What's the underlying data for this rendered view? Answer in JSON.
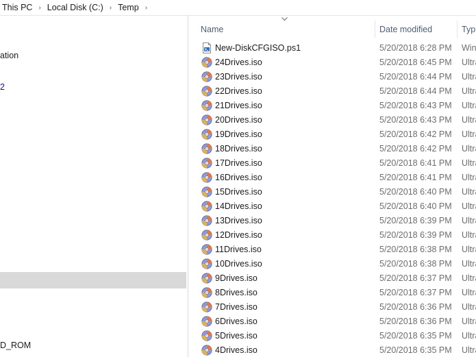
{
  "breadcrumb": {
    "items": [
      "This PC",
      "Local Disk (C:)",
      "Temp"
    ],
    "separator": "›"
  },
  "nav": {
    "items": [
      "ation",
      "2",
      "D_ROM"
    ]
  },
  "columns": {
    "name": "Name",
    "date": "Date modified",
    "type": "Typ"
  },
  "files": [
    {
      "name": "New-DiskCFGISO.ps1",
      "date": "5/20/2018 6:28 PM",
      "type": "Win",
      "icon": "powershell-script-icon"
    },
    {
      "name": "24Drives.iso",
      "date": "5/20/2018 6:45 PM",
      "type": "Ultra",
      "icon": "iso-disc-icon"
    },
    {
      "name": "23Drives.iso",
      "date": "5/20/2018 6:44 PM",
      "type": "Ultra",
      "icon": "iso-disc-icon"
    },
    {
      "name": "22Drives.iso",
      "date": "5/20/2018 6:44 PM",
      "type": "Ultra",
      "icon": "iso-disc-icon"
    },
    {
      "name": "21Drives.iso",
      "date": "5/20/2018 6:43 PM",
      "type": "Ultra",
      "icon": "iso-disc-icon"
    },
    {
      "name": "20Drives.iso",
      "date": "5/20/2018 6:43 PM",
      "type": "Ultra",
      "icon": "iso-disc-icon"
    },
    {
      "name": "19Drives.iso",
      "date": "5/20/2018 6:42 PM",
      "type": "Ultra",
      "icon": "iso-disc-icon"
    },
    {
      "name": "18Drives.iso",
      "date": "5/20/2018 6:42 PM",
      "type": "Ultra",
      "icon": "iso-disc-icon"
    },
    {
      "name": "17Drives.iso",
      "date": "5/20/2018 6:41 PM",
      "type": "Ultra",
      "icon": "iso-disc-icon"
    },
    {
      "name": "16Drives.iso",
      "date": "5/20/2018 6:41 PM",
      "type": "Ultra",
      "icon": "iso-disc-icon"
    },
    {
      "name": "15Drives.iso",
      "date": "5/20/2018 6:40 PM",
      "type": "Ultra",
      "icon": "iso-disc-icon"
    },
    {
      "name": "14Drives.iso",
      "date": "5/20/2018 6:40 PM",
      "type": "Ultra",
      "icon": "iso-disc-icon"
    },
    {
      "name": "13Drives.iso",
      "date": "5/20/2018 6:39 PM",
      "type": "Ultra",
      "icon": "iso-disc-icon"
    },
    {
      "name": "12Drives.iso",
      "date": "5/20/2018 6:39 PM",
      "type": "Ultra",
      "icon": "iso-disc-icon"
    },
    {
      "name": "11Drives.iso",
      "date": "5/20/2018 6:38 PM",
      "type": "Ultra",
      "icon": "iso-disc-icon"
    },
    {
      "name": "10Drives.iso",
      "date": "5/20/2018 6:38 PM",
      "type": "Ultra",
      "icon": "iso-disc-icon"
    },
    {
      "name": "9Drives.iso",
      "date": "5/20/2018 6:37 PM",
      "type": "Ultra",
      "icon": "iso-disc-icon"
    },
    {
      "name": "8Drives.iso",
      "date": "5/20/2018 6:37 PM",
      "type": "Ultra",
      "icon": "iso-disc-icon"
    },
    {
      "name": "7Drives.iso",
      "date": "5/20/2018 6:36 PM",
      "type": "Ultra",
      "icon": "iso-disc-icon"
    },
    {
      "name": "6Drives.iso",
      "date": "5/20/2018 6:36 PM",
      "type": "Ultra",
      "icon": "iso-disc-icon"
    },
    {
      "name": "5Drives.iso",
      "date": "5/20/2018 6:35 PM",
      "type": "Ultra",
      "icon": "iso-disc-icon"
    },
    {
      "name": "4Drives.iso",
      "date": "5/20/2018 6:35 PM",
      "type": "Ultra",
      "icon": "iso-disc-icon"
    }
  ],
  "colors": {
    "header_text": "#4c607a",
    "meta_text": "#6d6d6d",
    "nav_selected": "#d9d9d9",
    "nav_link": "#1a0dab"
  }
}
